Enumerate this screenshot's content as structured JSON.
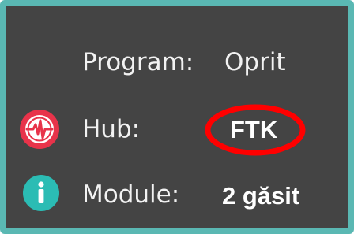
{
  "status_panel": {
    "program": {
      "label": "Program:",
      "value": "Oprit"
    },
    "hub": {
      "label": "Hub:",
      "value": "FTK",
      "icon": "hub-pulse-icon"
    },
    "module": {
      "label": "Module:",
      "value": "2 găsit",
      "icon": "info-icon"
    }
  },
  "colors": {
    "frame_border": "#5ab8b3",
    "panel_background": "#444444",
    "text": "#f2f2f2",
    "hub_icon": "#e8334a",
    "info_icon": "#2bbcb4",
    "highlight": "#ff0000"
  }
}
